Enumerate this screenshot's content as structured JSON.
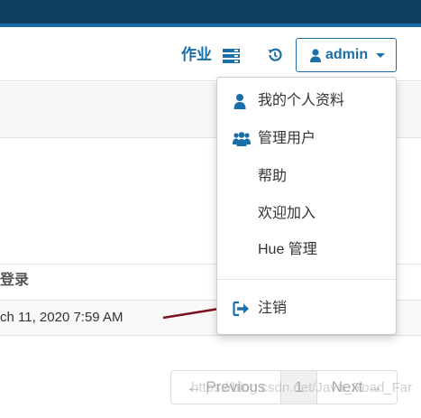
{
  "navbar": {
    "jobs_label": "作业",
    "user_label": "admin"
  },
  "table": {
    "header": "登录",
    "row_value": "ch 11, 2020 7:59 AM"
  },
  "user_menu": {
    "items": [
      {
        "label": "我的个人资料",
        "icon": "user-icon"
      },
      {
        "label": "管理用户",
        "icon": "users-icon"
      },
      {
        "label": "帮助",
        "icon": ""
      },
      {
        "label": "欢迎加入",
        "icon": ""
      },
      {
        "label": "Hue 管理",
        "icon": ""
      }
    ],
    "logout": {
      "label": "注销",
      "icon": "sign-out-icon"
    }
  },
  "pagination": {
    "previous": "← Previous",
    "page": "1",
    "next": "Next →"
  },
  "watermark": "https://blog.csdn.net/Java_Road_Far",
  "colors": {
    "accent": "#1a6fa8",
    "topbar": "#0e3e60",
    "annotation_arrow": "#7a1020"
  }
}
